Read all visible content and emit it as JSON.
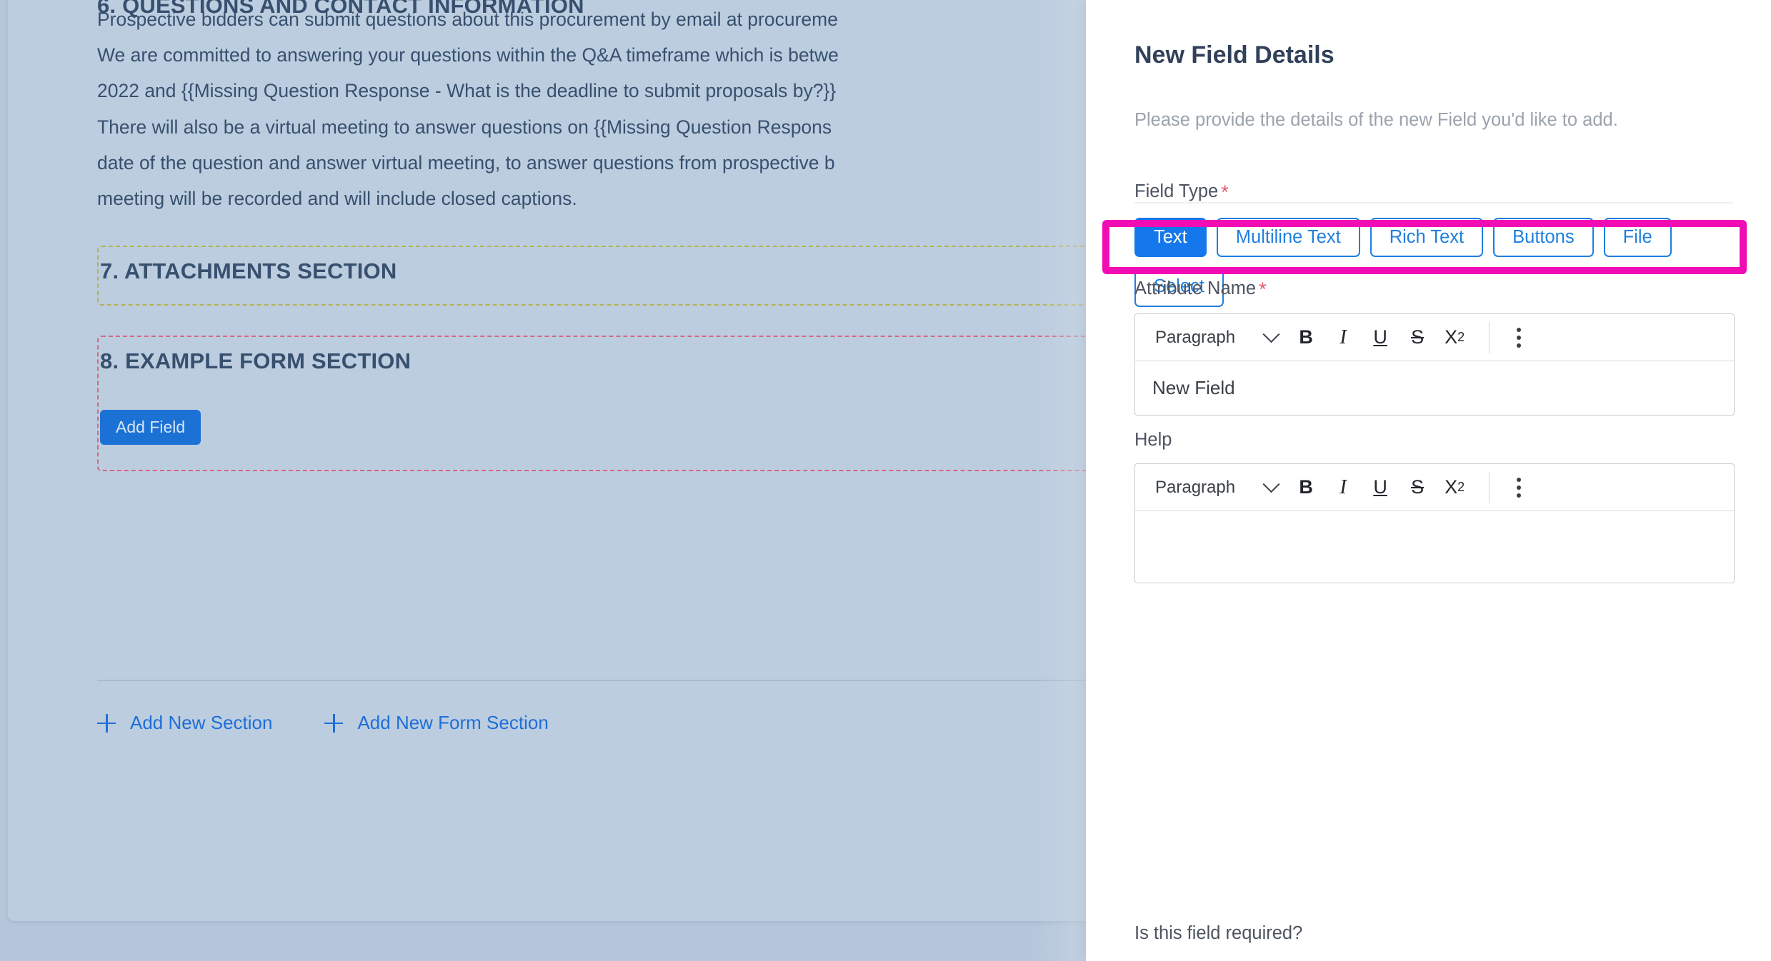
{
  "document": {
    "section6": {
      "heading": "6. QUESTIONS AND CONTACT INFORMATION",
      "para1_line1": "Prospective bidders can submit questions about this procurement by email at procureme",
      "para1_line2": "We are committed to answering your questions within the Q&A timeframe which is betwe",
      "para1_line3": "2022 and {{Missing Question Response - What is the deadline to submit proposals by?}}",
      "para2_line1": "There will also be a virtual meeting to answer questions on {{Missing Question Respons",
      "para2_line2": "date of the question and answer virtual meeting, to answer questions from prospective b",
      "para2_line3": "meeting will be recorded and will include closed captions."
    },
    "section7": {
      "heading": "7. ATTACHMENTS SECTION",
      "border_color": "#b5b352"
    },
    "section8": {
      "heading": "8. EXAMPLE FORM SECTION",
      "border_color": "#d4697f",
      "add_field_label": "Add Field"
    },
    "footer_links": [
      {
        "icon": "plus-icon",
        "label": "Add New Section"
      },
      {
        "icon": "plus-icon",
        "label": "Add New Form Section"
      }
    ]
  },
  "drawer": {
    "title": "New Field Details",
    "subtitle": "Please provide the details of the new Field you'd like to add.",
    "field_type": {
      "label": "Field Type",
      "required_marker": "*",
      "options": [
        {
          "label": "Text",
          "selected": true
        },
        {
          "label": "Multiline Text",
          "selected": false
        },
        {
          "label": "Rich Text",
          "selected": false
        },
        {
          "label": "Buttons",
          "selected": false
        },
        {
          "label": "File",
          "selected": false
        },
        {
          "label": "Select",
          "selected": false
        }
      ],
      "highlight_color": "#f20cb4",
      "selected_color": "#1478ec"
    },
    "attribute_name": {
      "label": "Attribute Name",
      "required_marker": "*",
      "toolbar": {
        "style_value": "Paragraph",
        "bold": "B",
        "italic": "I",
        "underline": "U",
        "strikethrough": "S",
        "subscript": "X",
        "subscript_index": "2"
      },
      "value": "New Field"
    },
    "help": {
      "label": "Help",
      "toolbar": {
        "style_value": "Paragraph",
        "bold": "B",
        "italic": "I",
        "underline": "U",
        "strikethrough": "S",
        "subscript": "X",
        "subscript_index": "2"
      },
      "value": ""
    },
    "required_question": "Is this field required?"
  }
}
